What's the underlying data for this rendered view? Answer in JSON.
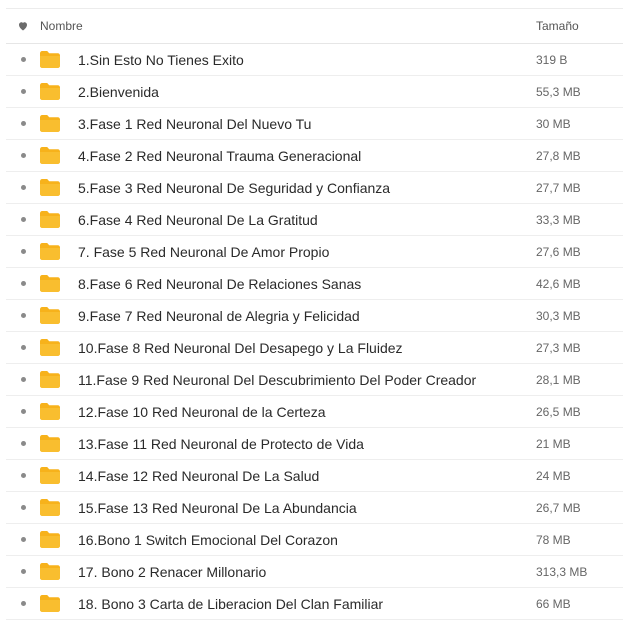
{
  "header": {
    "name_label": "Nombre",
    "size_label": "Tamaño"
  },
  "colors": {
    "folder": "#F7B21B",
    "bullet": "#8A8A8A"
  },
  "files": [
    {
      "name": "1.Sin Esto No Tienes Exito",
      "size": "319 B"
    },
    {
      "name": "2.Bienvenida",
      "size": "55,3 MB"
    },
    {
      "name": "3.Fase 1 Red Neuronal Del Nuevo Tu",
      "size": "30 MB"
    },
    {
      "name": "4.Fase 2 Red Neuronal Trauma Generacional",
      "size": "27,8 MB"
    },
    {
      "name": "5.Fase 3 Red Neuronal De Seguridad y Confianza",
      "size": "27,7 MB"
    },
    {
      "name": "6.Fase 4 Red Neuronal De La Gratitud",
      "size": "33,3 MB"
    },
    {
      "name": "7. Fase 5 Red Neuronal De Amor Propio",
      "size": "27,6 MB"
    },
    {
      "name": "8.Fase 6 Red Neuronal De Relaciones Sanas",
      "size": "42,6 MB"
    },
    {
      "name": "9.Fase 7 Red Neuronal de Alegria y Felicidad",
      "size": "30,3 MB"
    },
    {
      "name": "10.Fase 8 Red Neuronal Del Desapego y La Fluidez",
      "size": "27,3 MB"
    },
    {
      "name": "11.Fase 9 Red Neuronal Del Descubrimiento Del Poder Creador",
      "size": "28,1 MB"
    },
    {
      "name": "12.Fase 10 Red Neuronal de la Certeza",
      "size": "26,5 MB"
    },
    {
      "name": "13.Fase 11 Red Neuronal de Protecto de Vida",
      "size": "21 MB"
    },
    {
      "name": "14.Fase 12 Red Neuronal De La Salud",
      "size": "24 MB"
    },
    {
      "name": "15.Fase 13 Red Neuronal De La Abundancia",
      "size": "26,7 MB"
    },
    {
      "name": "16.Bono 1 Switch Emocional Del Corazon",
      "size": "78 MB"
    },
    {
      "name": "17. Bono 2 Renacer Millonario",
      "size": "313,3 MB"
    },
    {
      "name": "18. Bono 3 Carta de Liberacion Del Clan Familiar",
      "size": "66 MB"
    }
  ]
}
